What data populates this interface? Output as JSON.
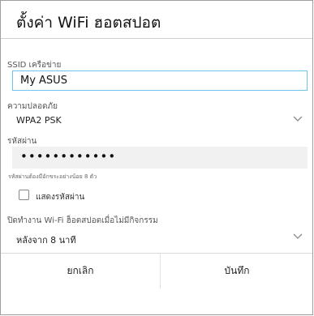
{
  "dialog": {
    "title": "ตั้งค่า WiFi ฮอตสปอต"
  },
  "ssid": {
    "label": "SSID เครือข่าย",
    "value": "My ASUS"
  },
  "security": {
    "label": "ความปลอดภัย",
    "selected": "WPA2 PSK"
  },
  "password": {
    "label": "รหัสผ่าน",
    "value": "••••••••••••",
    "hint": "รหัสผ่านต้องมีอักขระอย่างน้อย 8 ตัว"
  },
  "show_password": {
    "label": "แสดงรหัสผ่าน",
    "checked": false
  },
  "auto_off": {
    "label": "ปิดทำงาน Wi-Fi ฮ็อตสปอตเมื่อไม่มีกิจกรรม",
    "selected": "หลังจาก 8 นาที"
  },
  "buttons": {
    "cancel": "ยกเลิก",
    "save": "บันทึก"
  },
  "colors": {
    "input_focus_border": "#6ec6ea",
    "password_bg": "#f1f1f1",
    "divider": "#d0d0d0"
  },
  "icons": {
    "dropdown": "chevron-down-icon"
  }
}
